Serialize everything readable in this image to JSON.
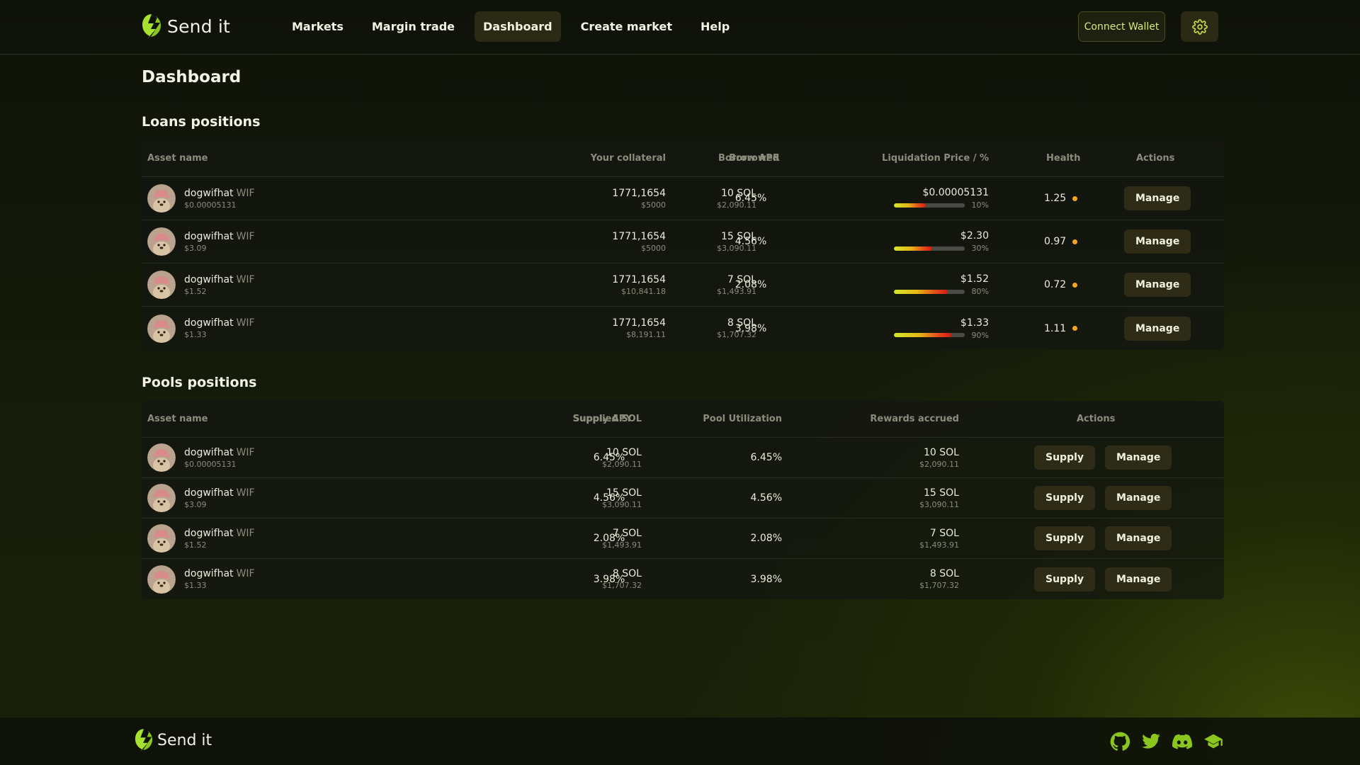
{
  "brand": {
    "name": "Send it"
  },
  "nav": [
    {
      "label": "Markets",
      "active": false
    },
    {
      "label": "Margin trade",
      "active": false
    },
    {
      "label": "Dashboard",
      "active": true
    },
    {
      "label": "Create market",
      "active": false
    },
    {
      "label": "Help",
      "active": false
    }
  ],
  "header": {
    "connect_label": "Connect Wallet",
    "settings_icon": "gear-icon"
  },
  "page": {
    "title": "Dashboard"
  },
  "loans": {
    "title": "Loans positions",
    "headers": {
      "asset": "Asset name",
      "collateral": "Your collateral",
      "borrowed": "Borrowed",
      "apr": "Borrow APR",
      "liq": "Liquidation Price / %",
      "health": "Health",
      "actions": "Actions"
    },
    "rows": [
      {
        "name": "dogwifhat",
        "ticker": "WIF",
        "price": "$0.00005131",
        "collateral": "1771,1654",
        "collateral_usd": "$5000",
        "borrowed": "10 SOL",
        "borrowed_usd": "$2,090.11",
        "apr": "6.45%",
        "liq_price": "$0.00005131",
        "liq_pct": "10%",
        "health": "1.25",
        "action": "Manage"
      },
      {
        "name": "dogwifhat",
        "ticker": "WIF",
        "price": "$3.09",
        "collateral": "1771,1654",
        "collateral_usd": "$5000",
        "borrowed": "15 SOL",
        "borrowed_usd": "$3,090.11",
        "apr": "4.56%",
        "liq_price": "$2.30",
        "liq_pct": "30%",
        "health": "0.97",
        "action": "Manage"
      },
      {
        "name": "dogwifhat",
        "ticker": "WIF",
        "price": "$1.52",
        "collateral": "1771,1654",
        "collateral_usd": "$10,841.18",
        "borrowed": "7 SOL",
        "borrowed_usd": "$1,493.91",
        "apr": "2.08%",
        "liq_price": "$1.52",
        "liq_pct": "80%",
        "health": "0.72",
        "action": "Manage"
      },
      {
        "name": "dogwifhat",
        "ticker": "WIF",
        "price": "$1.33",
        "collateral": "1771,1654",
        "collateral_usd": "$8,191.11",
        "borrowed": "8 SOL",
        "borrowed_usd": "$1,707.32",
        "apr": "3.98%",
        "liq_price": "$1.33",
        "liq_pct": "90%",
        "health": "1.11",
        "action": "Manage"
      }
    ]
  },
  "pools": {
    "title": "Pools positions",
    "headers": {
      "asset": "Asset name",
      "supplied": "Supplied SOL",
      "apy": "Supply APY",
      "util": "Pool Utilization",
      "rewards": "Rewards accrued",
      "actions": "Actions"
    },
    "rows": [
      {
        "name": "dogwifhat",
        "ticker": "WIF",
        "price": "$0.00005131",
        "supplied": "10 SOL",
        "supplied_usd": "$2,090.11",
        "apy": "6.45%",
        "util": "6.45%",
        "rewards": "10 SOL",
        "rewards_usd": "$2,090.11",
        "supply_label": "Supply",
        "manage_label": "Manage"
      },
      {
        "name": "dogwifhat",
        "ticker": "WIF",
        "price": "$3.09",
        "supplied": "15 SOL",
        "supplied_usd": "$3,090.11",
        "apy": "4.56%",
        "util": "4.56%",
        "rewards": "15 SOL",
        "rewards_usd": "$3,090.11",
        "supply_label": "Supply",
        "manage_label": "Manage"
      },
      {
        "name": "dogwifhat",
        "ticker": "WIF",
        "price": "$1.52",
        "supplied": "7 SOL",
        "supplied_usd": "$1,493.91",
        "apy": "2.08%",
        "util": "2.08%",
        "rewards": "7 SOL",
        "rewards_usd": "$1,493.91",
        "supply_label": "Supply",
        "manage_label": "Manage"
      },
      {
        "name": "dogwifhat",
        "ticker": "WIF",
        "price": "$1.33",
        "supplied": "8 SOL",
        "supplied_usd": "$1,707.32",
        "apy": "3.98%",
        "util": "3.98%",
        "rewards": "8 SOL",
        "rewards_usd": "$1,707.32",
        "supply_label": "Supply",
        "manage_label": "Manage"
      }
    ]
  },
  "footer": {
    "brand": "Send it",
    "socials": [
      "github-icon",
      "twitter-icon",
      "discord-icon",
      "docs-icon"
    ]
  },
  "colors": {
    "accent": "#a3e635",
    "health_dot": "#f5a623",
    "button_bg": "#2e2c16",
    "connect_text": "#d7e87c"
  }
}
